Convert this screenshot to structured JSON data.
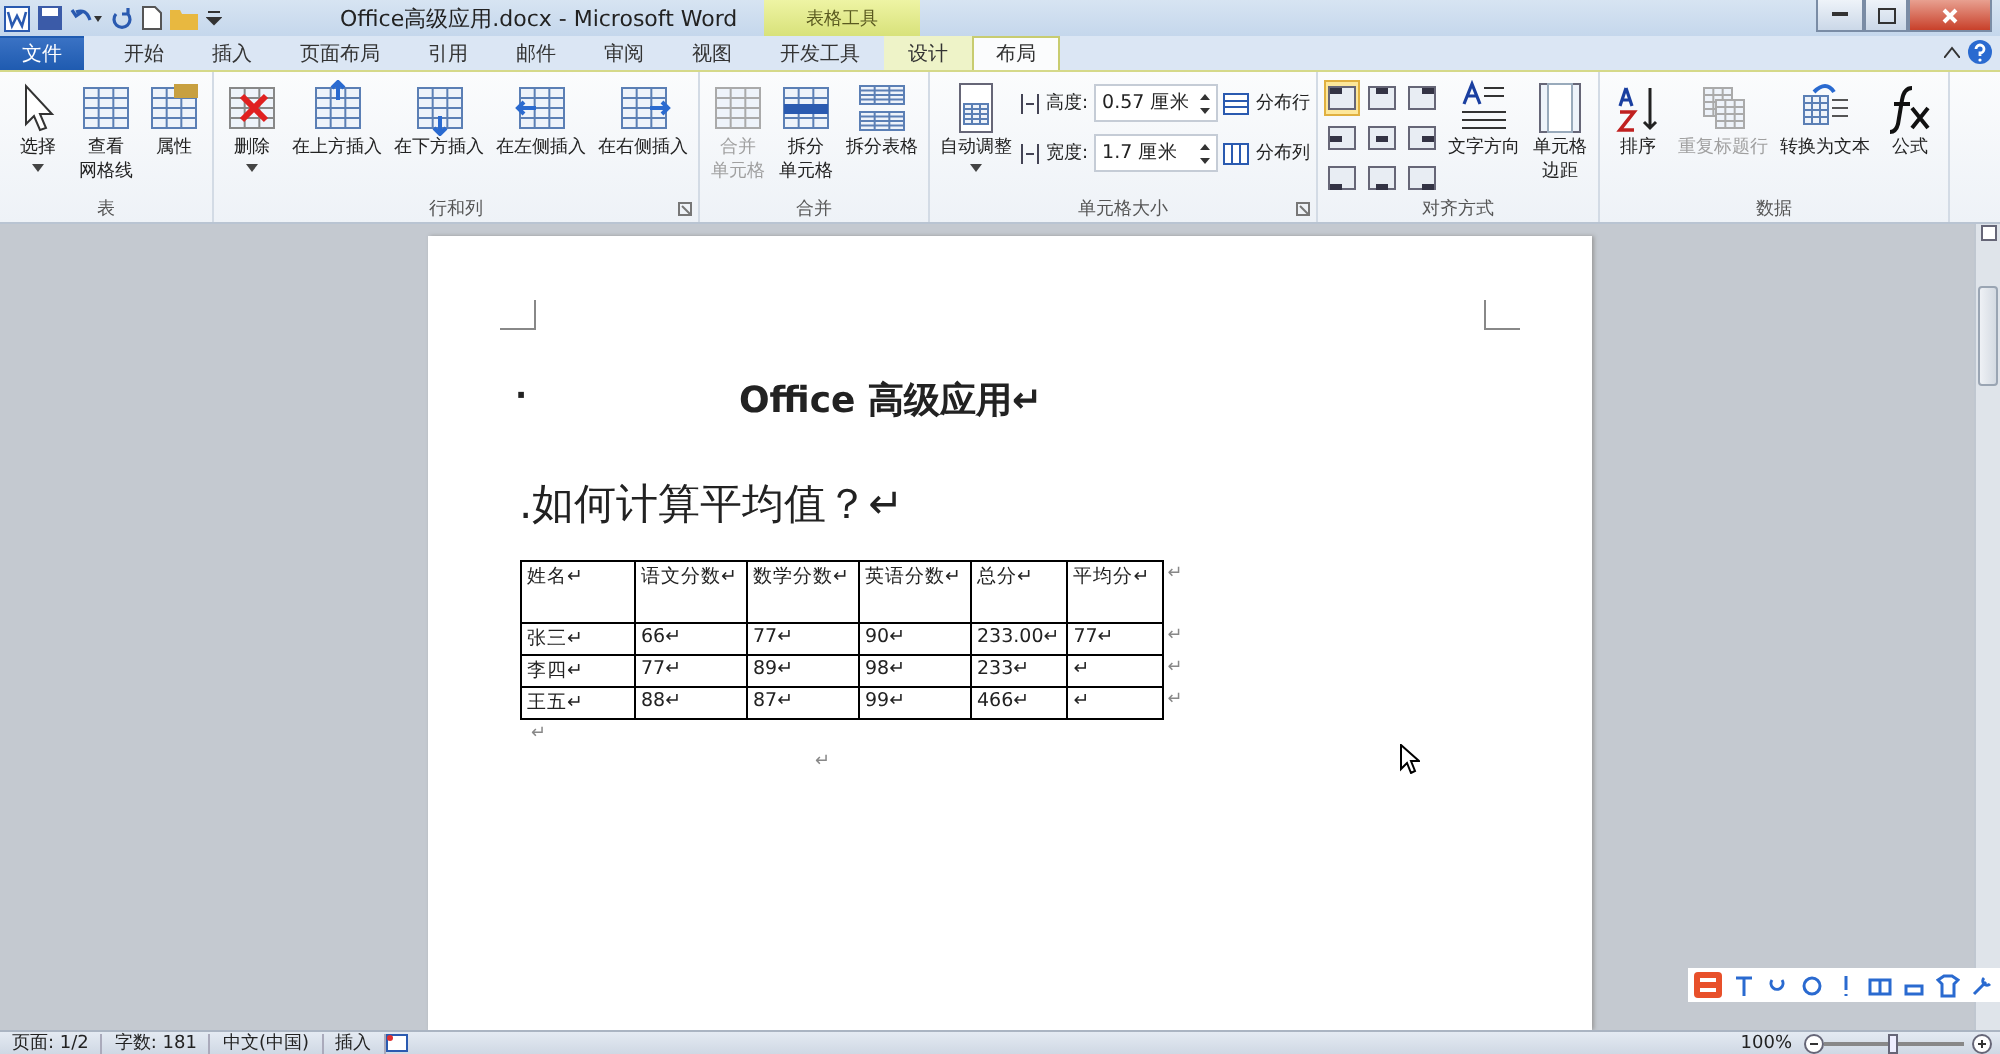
{
  "title_bar": {
    "title": "Office高级应用.docx - Microsoft Word",
    "context_label": "表格工具"
  },
  "tabs": [
    {
      "label": "文件",
      "kind": "file",
      "selected": false
    },
    {
      "label": "开始",
      "kind": "tab",
      "selected": false
    },
    {
      "label": "插入",
      "kind": "tab",
      "selected": false
    },
    {
      "label": "页面布局",
      "kind": "tab",
      "selected": false
    },
    {
      "label": "引用",
      "kind": "tab",
      "selected": false
    },
    {
      "label": "邮件",
      "kind": "tab",
      "selected": false
    },
    {
      "label": "审阅",
      "kind": "tab",
      "selected": false
    },
    {
      "label": "视图",
      "kind": "tab",
      "selected": false
    },
    {
      "label": "开发工具",
      "kind": "tab",
      "selected": false
    },
    {
      "label": "设计",
      "kind": "context",
      "selected": false
    },
    {
      "label": "布局",
      "kind": "context",
      "selected": true
    }
  ],
  "ribbon": [
    {
      "label": "表",
      "launcher": false,
      "items": [
        {
          "kind": "large",
          "lines": [
            "选择"
          ],
          "dropdown": true,
          "disabled": false
        },
        {
          "kind": "large",
          "lines": [
            "查看",
            "网格线"
          ],
          "dropdown": false,
          "disabled": false
        },
        {
          "kind": "large",
          "lines": [
            "属性"
          ],
          "dropdown": false,
          "disabled": false
        }
      ]
    },
    {
      "label": "行和列",
      "launcher": true,
      "items": [
        {
          "kind": "large",
          "lines": [
            "删除"
          ],
          "dropdown": true,
          "disabled": false
        },
        {
          "kind": "large",
          "lines": [
            "在上方插入"
          ],
          "dropdown": false,
          "disabled": false
        },
        {
          "kind": "large",
          "lines": [
            "在下方插入"
          ],
          "dropdown": false,
          "disabled": false
        },
        {
          "kind": "large",
          "lines": [
            "在左侧插入"
          ],
          "dropdown": false,
          "disabled": false
        },
        {
          "kind": "large",
          "lines": [
            "在右侧插入"
          ],
          "dropdown": false,
          "disabled": false
        }
      ]
    },
    {
      "label": "合并",
      "launcher": false,
      "items": [
        {
          "kind": "large",
          "lines": [
            "合并",
            "单元格"
          ],
          "dropdown": false,
          "disabled": true
        },
        {
          "kind": "large",
          "lines": [
            "拆分",
            "单元格"
          ],
          "dropdown": false,
          "disabled": false
        },
        {
          "kind": "large",
          "lines": [
            "拆分表格"
          ],
          "dropdown": false,
          "disabled": false
        }
      ]
    },
    {
      "label": "单元格大小",
      "launcher": true,
      "items": [
        {
          "kind": "large",
          "lines": [
            "自动调整"
          ],
          "dropdown": true,
          "disabled": false
        },
        {
          "kind": "fields",
          "fields": [
            {
              "label": "高度:",
              "value": "0.57 厘米"
            },
            {
              "label": "宽度:",
              "value": "1.7 厘米"
            }
          ]
        },
        {
          "kind": "smalls",
          "buttons": [
            "分布行",
            "分布列"
          ]
        }
      ]
    },
    {
      "label": "对齐方式",
      "launcher": false,
      "items": [
        {
          "kind": "align",
          "cells": [
            {
              "selected": true
            },
            {
              "selected": false
            },
            {
              "selected": false
            },
            {
              "selected": false
            },
            {
              "selected": false
            },
            {
              "selected": false
            },
            {
              "selected": false
            },
            {
              "selected": false
            },
            {
              "selected": false
            }
          ]
        },
        {
          "kind": "large",
          "lines": [
            "文字方向"
          ],
          "dropdown": false,
          "disabled": false
        },
        {
          "kind": "large",
          "lines": [
            "单元格",
            "边距"
          ],
          "dropdown": false,
          "disabled": false
        }
      ]
    },
    {
      "label": "数据",
      "launcher": false,
      "items": [
        {
          "kind": "large",
          "lines": [
            "排序"
          ],
          "dropdown": false,
          "disabled": false
        },
        {
          "kind": "large",
          "lines": [
            "重复标题行"
          ],
          "dropdown": false,
          "disabled": true
        },
        {
          "kind": "large",
          "lines": [
            "转换为文本"
          ],
          "dropdown": false,
          "disabled": false
        },
        {
          "kind": "large",
          "lines": [
            "公式"
          ],
          "dropdown": false,
          "disabled": false
        }
      ]
    }
  ],
  "document": {
    "bullet": "·",
    "title": "Office 高级应用↵",
    "heading": ".如何计算平均值？↵",
    "table": {
      "header": [
        "姓名↵",
        "语文分数↵",
        "数学分数↵",
        "英语分数↵",
        "总分↵",
        "平均分↵"
      ],
      "header_end": "↵",
      "rows": [
        {
          "cells": [
            "张三↵",
            "66↵",
            "77↵",
            "90↵",
            "233.00↵",
            "77↵"
          ],
          "end": "↵"
        },
        {
          "cells": [
            "李四↵",
            "77↵",
            "89↵",
            "98↵",
            "233↵",
            "↵"
          ],
          "end": "↵"
        },
        {
          "cells": [
            "王五↵",
            "88↵",
            "87↵",
            "99↵",
            "466↵",
            "↵"
          ],
          "end": "↵"
        }
      ]
    },
    "after": [
      "↵",
      "↵"
    ]
  },
  "status_bar": {
    "items": [
      "页面: 1/2",
      "字数: 181",
      "中文(中国)",
      "插入"
    ],
    "zoom": "100%",
    "zoom_slider": {
      "level": 0.5
    }
  }
}
